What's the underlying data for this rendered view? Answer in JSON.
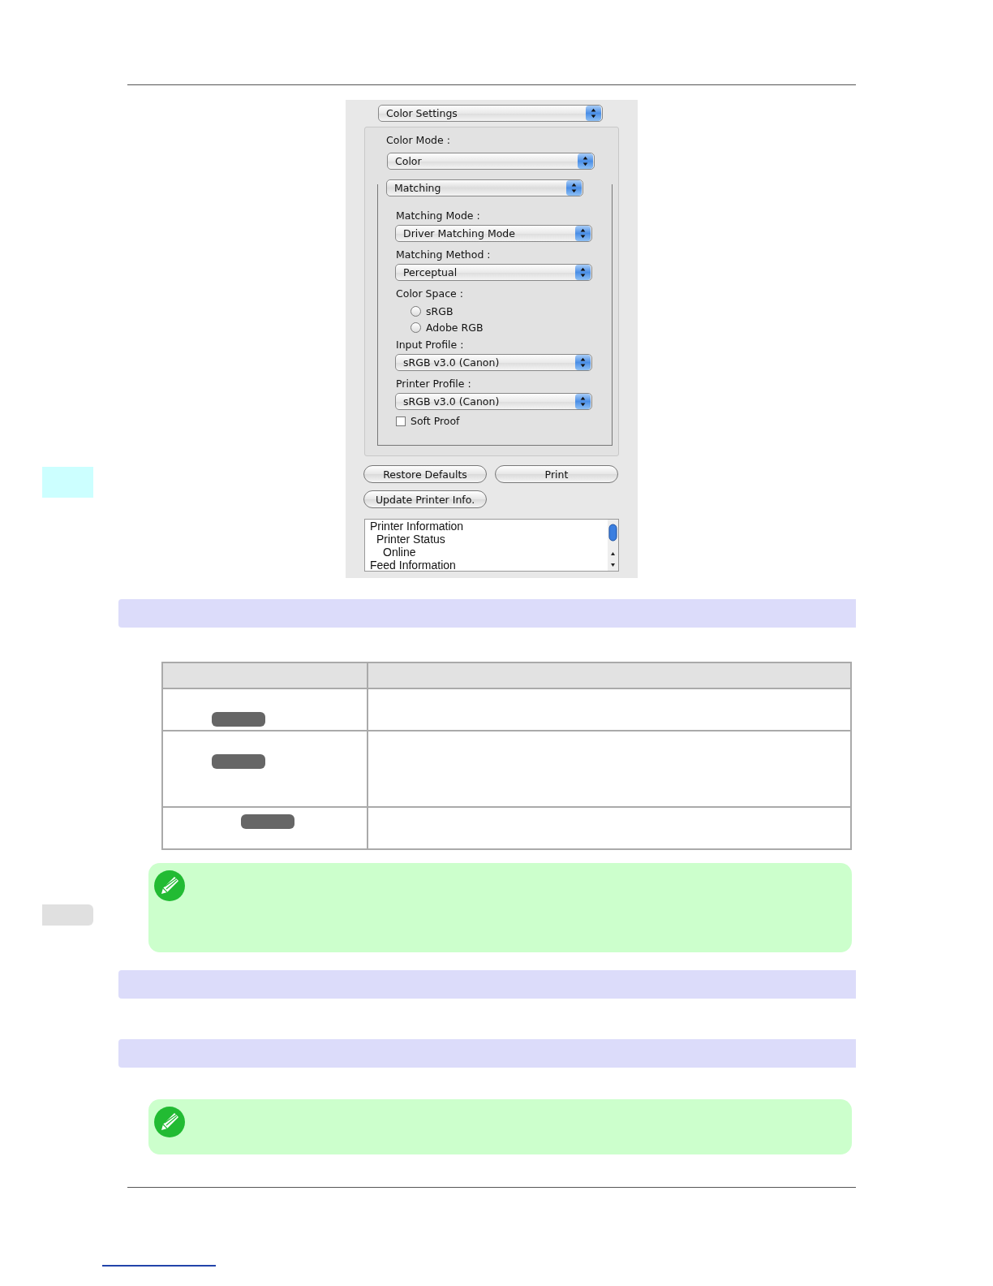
{
  "dialog": {
    "panel_popup": "Color Settings",
    "color_mode": {
      "label": "Color Mode :",
      "value": "Color"
    },
    "matching_popup": "Matching",
    "fields": [
      {
        "kind": "popup",
        "label": "Matching Mode :",
        "value": "Driver Matching Mode"
      },
      {
        "kind": "popup",
        "label": "Matching Method :",
        "value": "Perceptual"
      },
      {
        "kind": "radios",
        "label": "Color Space :",
        "options": [
          {
            "label": "sRGB",
            "selected": false
          },
          {
            "label": "Adobe RGB",
            "selected": false
          }
        ]
      },
      {
        "kind": "popup",
        "label": "Input Profile :",
        "value": "sRGB v3.0 (Canon)"
      },
      {
        "kind": "popup",
        "label": "Printer Profile :",
        "value": "sRGB v3.0 (Canon)"
      },
      {
        "kind": "checkbox",
        "label": "Soft Proof",
        "checked": false
      }
    ],
    "buttons": [
      "Restore Defaults",
      "Print",
      "Update Printer Info."
    ],
    "info_tree": [
      {
        "label": "Printer Information",
        "children": [
          {
            "label": "Printer Status",
            "children": [
              {
                "label": "Online"
              }
            ]
          }
        ]
      },
      {
        "label": "Feed Information"
      }
    ]
  },
  "side_tabs": [
    {
      "selected": true
    },
    {
      "selected": false
    }
  ]
}
